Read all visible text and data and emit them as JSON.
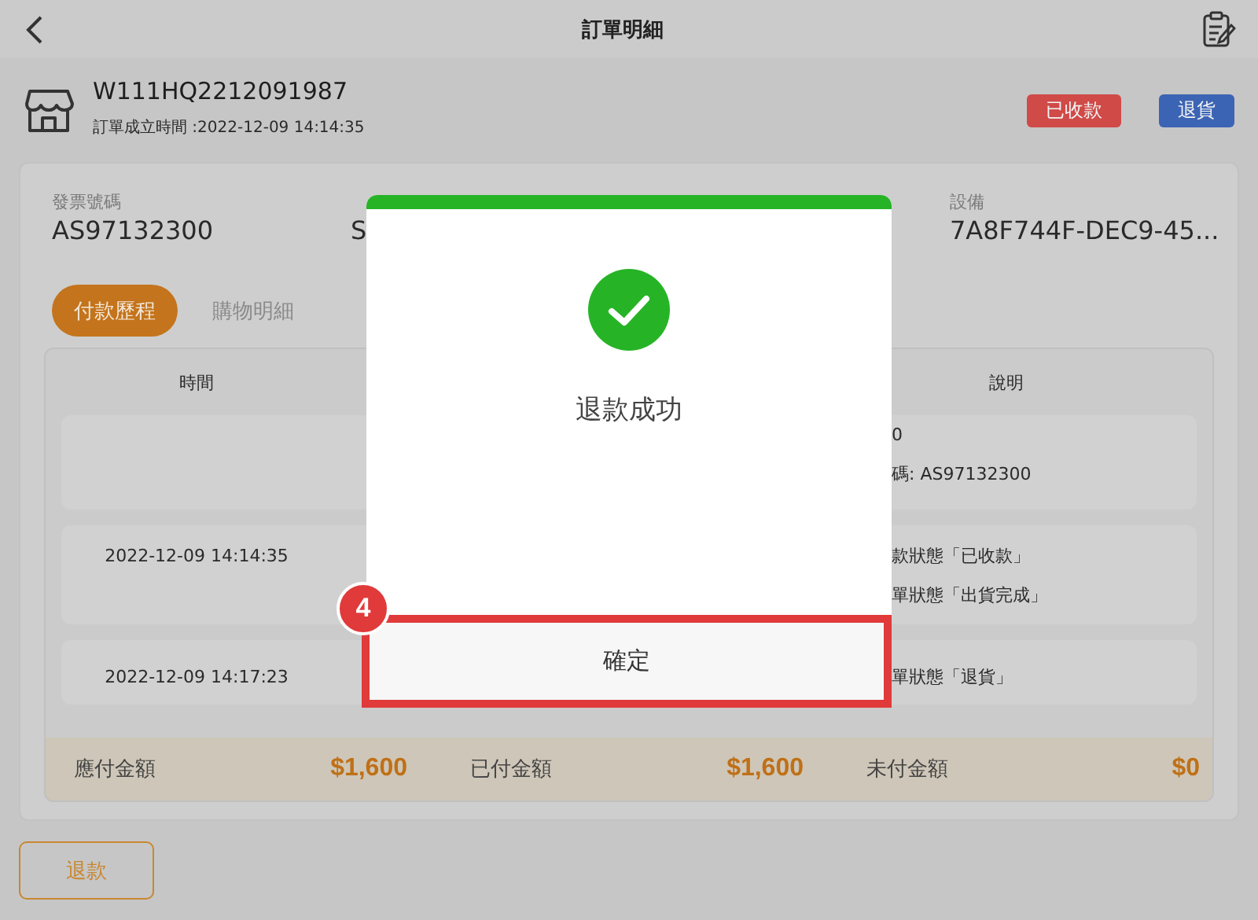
{
  "top_bar": {
    "title": "訂單明細"
  },
  "order": {
    "number": "W111HQ2212091987",
    "created": "訂單成立時間 :2022-12-09  14:14:35",
    "badges": [
      {
        "label": "已收款",
        "color": "#d04a48"
      },
      {
        "label": "退貨",
        "color": "#3c64b4"
      }
    ]
  },
  "fields": [
    {
      "label": "發票號碼",
      "value": "AS97132300"
    },
    {
      "value": "S"
    },
    {
      "label": "設備",
      "value": "7A8F744F-DEC9-45..."
    }
  ],
  "tabs": [
    {
      "label": "付款歷程",
      "selected": true
    },
    {
      "label": "購物明細",
      "selected": false
    }
  ],
  "table": {
    "columns": [
      "時間",
      "說明"
    ],
    "rows": [
      {
        "time": "",
        "description": [
          "0",
          "碼: AS97132300"
        ]
      },
      {
        "time": "2022-12-09  14:14:35",
        "description": [
          "款狀態「已收款」",
          "單狀態「出貨完成」"
        ]
      },
      {
        "time": "2022-12-09  14:17:23",
        "description": [
          "單狀態「退貨」"
        ]
      }
    ],
    "totals": [
      {
        "label": "應付金額",
        "amount": "$1,600"
      },
      {
        "label": "已付金額",
        "amount": "$1,600"
      },
      {
        "label": "未付金額",
        "amount": "$0"
      }
    ]
  },
  "refund_button": "退款",
  "dialog": {
    "title": "退款成功",
    "confirm_button": "確定",
    "step_badge": "4"
  }
}
